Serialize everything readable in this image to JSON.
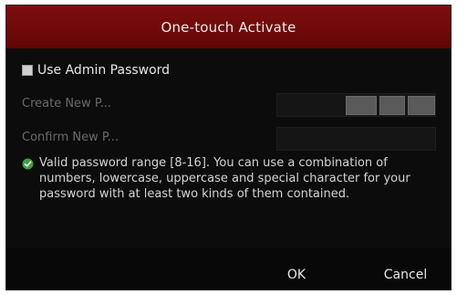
{
  "dialog": {
    "title": "One-touch Activate",
    "use_admin_password": {
      "label": "Use Admin Password",
      "checked": false
    },
    "fields": {
      "create_label": "Create New P...",
      "confirm_label": "Confirm New P...",
      "create_value": "",
      "confirm_value": ""
    },
    "hint": {
      "icon": "check-circle-icon",
      "text": "Valid password range [8-16]. You can use a combination of numbers, lowercase, uppercase and special character for your password with at least two kinds of them contained."
    },
    "buttons": {
      "ok": "OK",
      "cancel": "Cancel"
    },
    "colors": {
      "title_bar": "#6e0a0a",
      "background": "#0c0c0c",
      "hint_icon": "#3f9e3f"
    }
  }
}
